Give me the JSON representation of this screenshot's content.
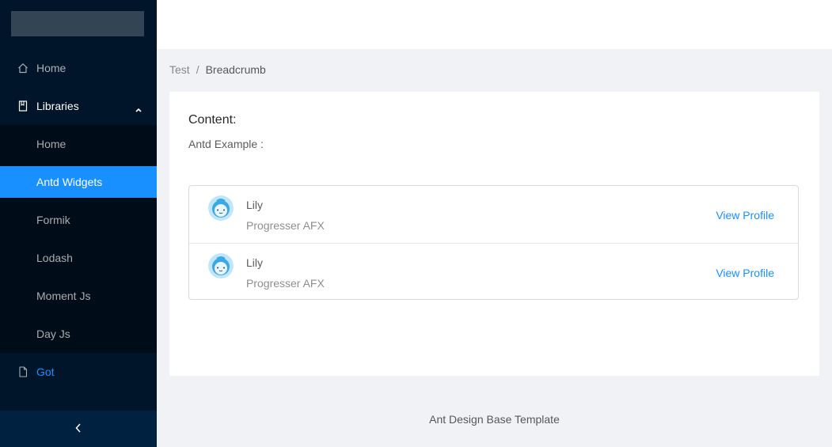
{
  "sidebar": {
    "items": [
      {
        "label": "Home",
        "icon": "home-icon"
      },
      {
        "label": "Libraries",
        "icon": "book-icon",
        "expanded": true,
        "children": [
          {
            "label": "Home"
          },
          {
            "label": "Antd Widgets",
            "selected": true
          },
          {
            "label": "Formik"
          },
          {
            "label": "Lodash"
          },
          {
            "label": "Moment Js"
          },
          {
            "label": "Day Js"
          }
        ]
      },
      {
        "label": "Got",
        "icon": "file-icon"
      }
    ],
    "collapse_icon": "chevron-left-icon"
  },
  "breadcrumb": {
    "items": [
      "Test",
      "Breadcrumb"
    ],
    "separator": "/"
  },
  "content": {
    "title": "Content:",
    "subtitle": "Antd Example :",
    "list": [
      {
        "name": "Lily",
        "description": "Progresser AFX",
        "action": "View Profile"
      },
      {
        "name": "Lily",
        "description": "Progresser AFX",
        "action": "View Profile"
      }
    ]
  },
  "footer": {
    "text": "Ant Design Base Template"
  },
  "colors": {
    "sider_bg": "#001529",
    "submenu_bg": "#000c17",
    "primary": "#1890ff",
    "page_bg": "#f0f2f5"
  }
}
